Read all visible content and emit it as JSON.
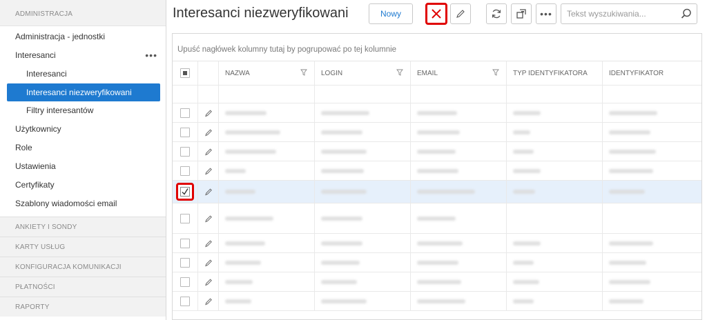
{
  "sidebar": {
    "top_section": "ADMINISTRACJA",
    "items": [
      {
        "label": "Administracja - jednostki"
      },
      {
        "label": "Interesanci",
        "more": "•••"
      },
      {
        "label": "Interesanci"
      },
      {
        "label": "Interesanci niezweryfikowani"
      },
      {
        "label": "Filtry interesantów"
      },
      {
        "label": "Użytkownicy"
      },
      {
        "label": "Role"
      },
      {
        "label": "Ustawienia"
      },
      {
        "label": "Certyfikaty"
      },
      {
        "label": "Szablony wiadomości email"
      }
    ],
    "sections": [
      "ANKIETY I SONDY",
      "KARTY USŁUG",
      "KONFIGURACJA KOMUNIKACJI",
      "PŁATNOŚCI",
      "RAPORTY"
    ]
  },
  "header": {
    "title": "Interesanci niezweryfikowani",
    "new_label": "Nowy",
    "more_label": "•••",
    "search_placeholder": "Tekst wyszukiwania...",
    "icons": [
      "close-icon",
      "pencil-icon",
      "refresh-icon",
      "export-icon",
      "more-icon",
      "search-icon"
    ]
  },
  "grid": {
    "group_panel_text": "Upuść nagłówek kolumny tutaj by pogrupować po tej kolumnie",
    "columns": [
      "NAZWA",
      "LOGIN",
      "EMAIL",
      "TYP IDENTYFIKATORA",
      "IDENTYFIKATOR"
    ],
    "rows_note_colors": {
      "selected_row": "#e6f0fb",
      "highlight": "#e00000",
      "accent": "#1e7ad0"
    }
  }
}
